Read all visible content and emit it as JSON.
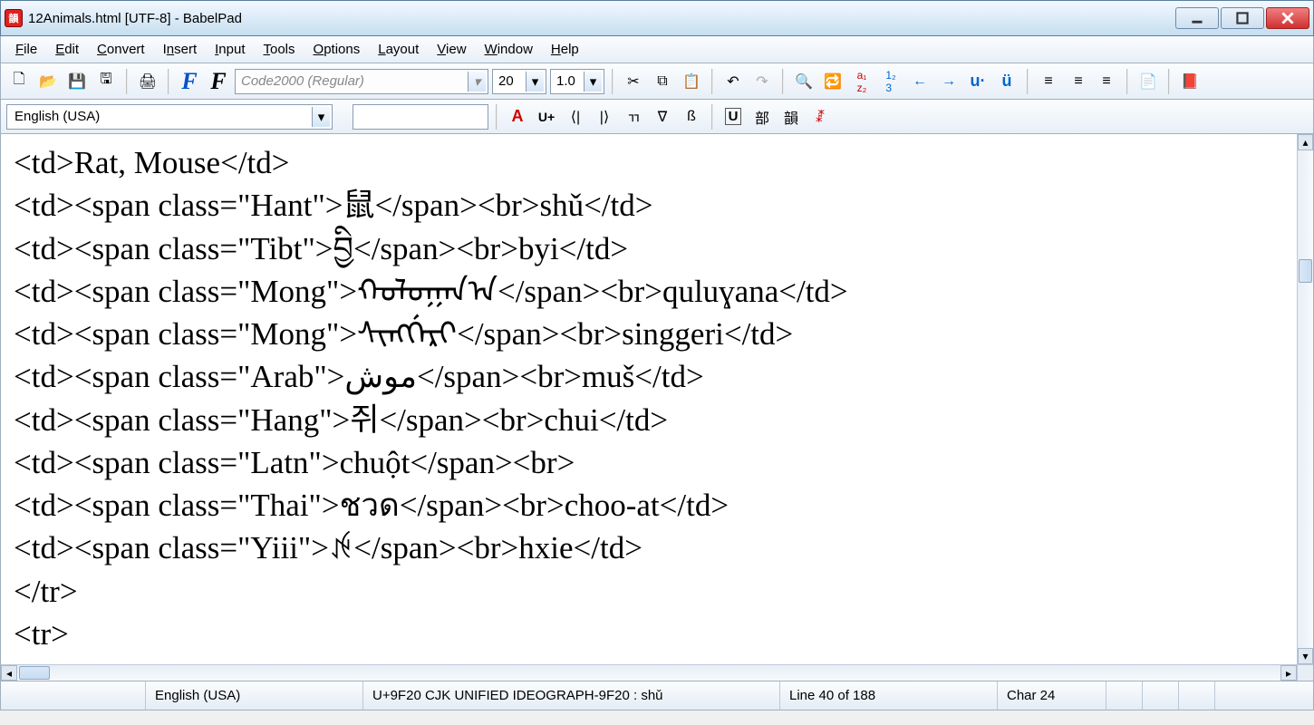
{
  "title": "12Animals.html [UTF-8] - BabelPad",
  "menu": [
    "File",
    "Edit",
    "Convert",
    "Insert",
    "Input",
    "Tools",
    "Options",
    "Layout",
    "View",
    "Window",
    "Help"
  ],
  "font_name": "Code2000 (Regular)",
  "font_size": "20",
  "line_spacing": "1.0",
  "language": "English (USA)",
  "editor_lines": [
    "<td>Rat, Mouse</td>",
    "<td><span class=\"Hant\">鼠</span><br>shǔ</td>",
    "<td><span class=\"Tibt\">བྱི</span><br>byi</td>",
    "<td><span class=\"Mong\">ᠬᠤᠯᠤᠭᠠᠨ᠎ᠠ</span><br>quluɣana</td>",
    "<td><span class=\"Mong\">ᠰᡳᠩᡤᡝᡵᡳ</span><br>singgeri</td>",
    "<td><span class=\"Arab\">موش</span><br>muš</td>",
    "<td><span class=\"Hang\">쥐</span><br>chui</td>",
    "<td><span class=\"Latn\">chuột</span><br>",
    "<td><span class=\"Thai\">ชวด</span><br>choo-at</td>",
    "<td><span class=\"Yiii\">ꉌ</span><br>hxie</td>",
    "</tr>",
    "<tr>"
  ],
  "status": {
    "lang": "English (USA)",
    "codepoint": "U+9F20 CJK UNIFIED IDEOGRAPH-9F20 : shǔ",
    "line": "Line 40 of 188",
    "char": "Char 24"
  }
}
